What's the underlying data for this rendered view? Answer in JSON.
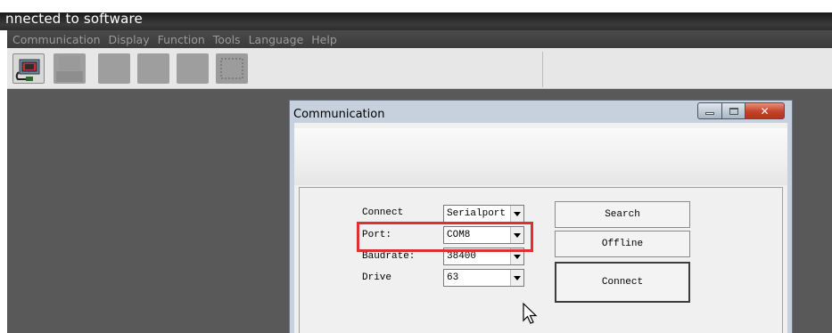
{
  "window": {
    "title": "nnected to software"
  },
  "menu": {
    "items": [
      "Communication",
      "Display",
      "Function",
      "Tools",
      "Language",
      "Help"
    ]
  },
  "toolbar": {
    "icons": [
      "serial-port-icon",
      "plug-icon",
      "module-icon",
      "module-icon",
      "module-icon",
      "chip-icon"
    ]
  },
  "dialog": {
    "title": "Communication",
    "fields": {
      "connect": {
        "label": "Connect",
        "value": "Serialport"
      },
      "port": {
        "label": "Port:",
        "value": "COM8"
      },
      "baudrate": {
        "label": "Baudrate:",
        "value": "38400"
      },
      "drive": {
        "label": "Drive",
        "value": "63"
      }
    },
    "buttons": {
      "search": "Search",
      "offline": "Offline",
      "connect": "Connect"
    }
  },
  "colors": {
    "highlight": "#e0302c",
    "client_bg": "#595959",
    "titlebar": "#2a2a2a"
  }
}
